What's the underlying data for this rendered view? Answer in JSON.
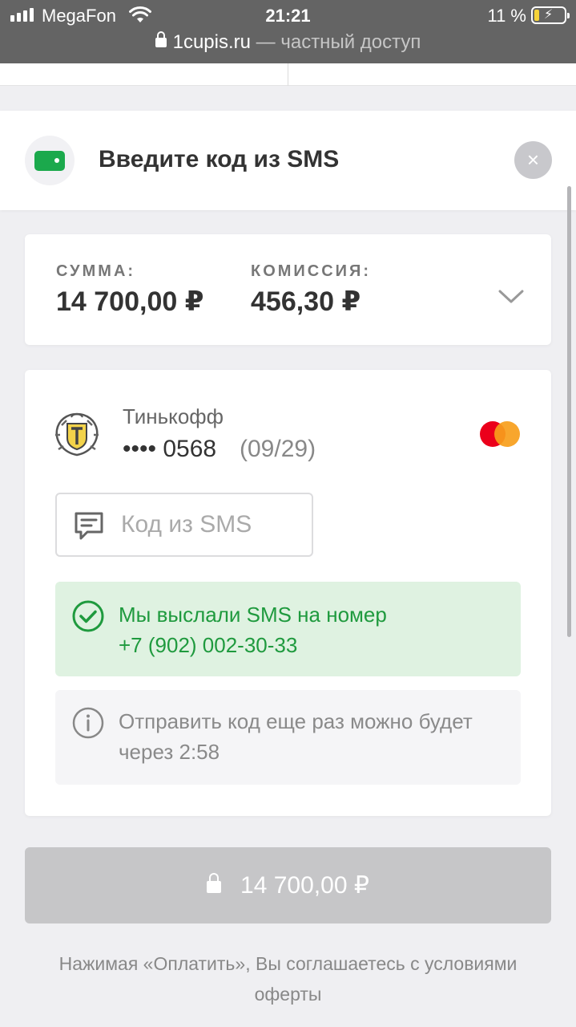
{
  "status_bar": {
    "carrier": "MegaFon",
    "time": "21:21",
    "battery_percent": "11 %",
    "battery_level": 0.11,
    "url_domain": "1cupis.ru",
    "url_suffix": "— частный доступ"
  },
  "header": {
    "title": "Введите код из SMS",
    "close_symbol": "×"
  },
  "summary": {
    "amount_label": "СУММА:",
    "amount_value": "14 700,00 ₽",
    "commission_label": "КОМИССИЯ:",
    "commission_value": "456,30 ₽"
  },
  "card": {
    "bank_name": "Тинькофф",
    "masked_number": "•••• 0568",
    "expiry": "(09/29)",
    "network": "mastercard"
  },
  "sms_input": {
    "placeholder": "Код из SMS",
    "value": ""
  },
  "success_notice": {
    "line1": "Мы выслали SMS на номер",
    "line2": "+7 (902) 002-30-33"
  },
  "resend_notice": {
    "text": "Отправить код еще раз можно будет через 2:58"
  },
  "pay_button": {
    "label": "14 700,00 ₽"
  },
  "terms_text": "Нажимая «Оплатить», Вы соглашаетесь с условиями оферты",
  "colors": {
    "accent_green": "#1ba94c",
    "success_text": "#1f9a3e",
    "success_bg": "#dff2e1",
    "disabled_button": "#c6c6c8"
  },
  "icons": {
    "wallet": "wallet-icon",
    "close": "close-icon",
    "chevron": "chevron-down-icon",
    "message": "message-icon",
    "check": "check-circle-icon",
    "info": "info-icon",
    "lock": "lock-icon"
  }
}
